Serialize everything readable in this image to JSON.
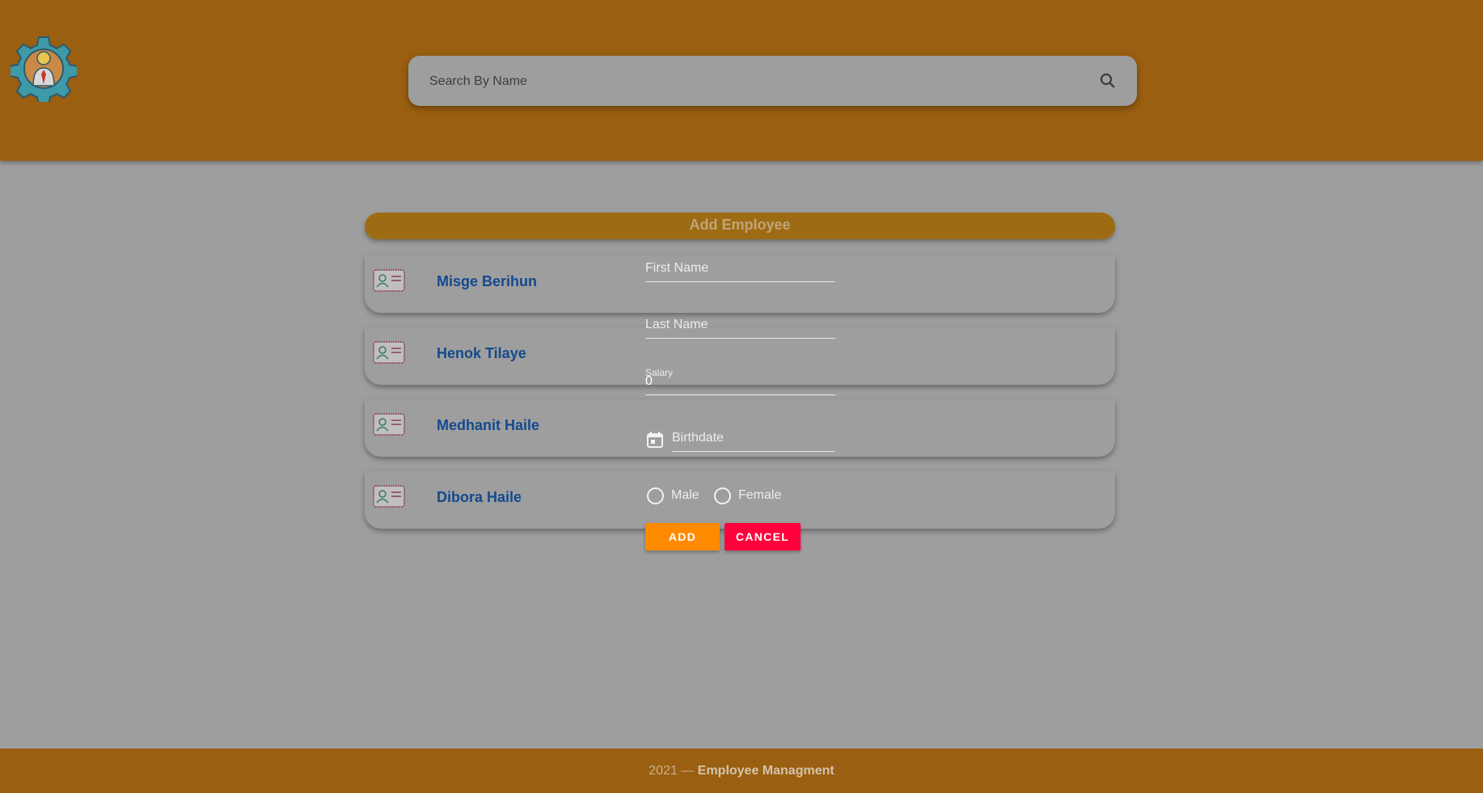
{
  "header": {
    "logo_name": "gear-person-logo",
    "search": {
      "placeholder": "Search By Name",
      "value": ""
    }
  },
  "add_bar": {
    "label": "Add Employee"
  },
  "employees": [
    {
      "name": "Misge Berihun"
    },
    {
      "name": "Henok Tilaye"
    },
    {
      "name": "Medhanit Haile"
    },
    {
      "name": "Dibora Haile"
    }
  ],
  "form": {
    "first_name_label": "First Name",
    "last_name_label": "Last Name",
    "salary_label": "Salary",
    "salary_value": "0",
    "birthdate_label": "Birthdate",
    "gender_options": [
      "Male",
      "Female"
    ],
    "add_button": "ADD",
    "cancel_button": "CANCEL"
  },
  "footer": {
    "year": "2021",
    "separator": " — ",
    "app_name": "Employee Managment"
  },
  "colors": {
    "header_bg": "#9a5f10",
    "page_bg": "#9e9e9e",
    "add_bar_bg": "#9d6b13",
    "name_color": "#134a8e",
    "add_button": "#ff8a00",
    "cancel_button": "#ff003d"
  }
}
